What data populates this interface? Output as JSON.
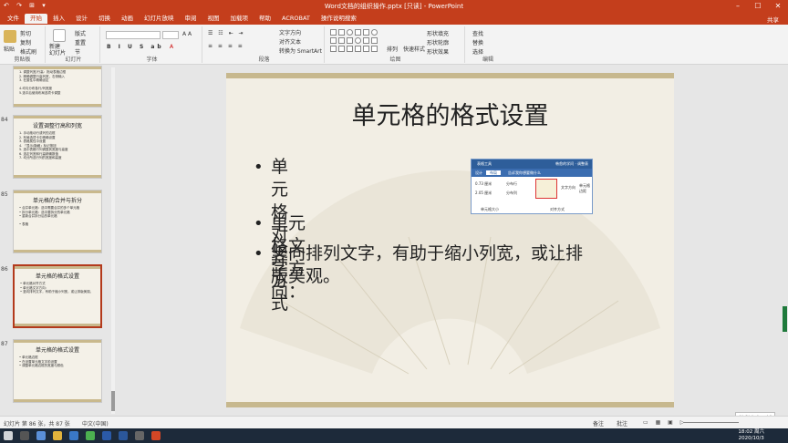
{
  "window": {
    "title": "Word文档的组织操作.pptx [只读] - PowerPoint",
    "qat": "↶ ↷ ⊞ ▾"
  },
  "tabs": [
    "文件",
    "开始",
    "插入",
    "设计",
    "切换",
    "动画",
    "幻灯片放映",
    "审阅",
    "视图",
    "加载项",
    "帮助",
    "ACROBAT",
    "操作说明搜索"
  ],
  "share": "共享",
  "ribbon": {
    "clipboard": {
      "label": "剪贴板",
      "paste": "粘贴",
      "cut": "剪切",
      "copy": "复制",
      "painter": "格式刷"
    },
    "slides": {
      "label": "幻灯片",
      "new": "新建\n幻灯片",
      "layout": "版式",
      "reset": "重置",
      "section": "节"
    },
    "font": {
      "label": "字体"
    },
    "paragraph": {
      "label": "段落",
      "text_dir": "文字方向",
      "align_text": "对齐文本",
      "smartart": "转换为 SmartArt"
    },
    "drawing": {
      "label": "绘图",
      "arrange": "排列",
      "quick_styles": "快速样式",
      "shape_fill": "形状填充",
      "shape_outline": "形状轮廓",
      "shape_effects": "形状效果"
    },
    "editing": {
      "label": "编辑",
      "find": "查找",
      "replace": "替换",
      "select": "选择"
    }
  },
  "thumbnails": [
    {
      "num": "",
      "title": "",
      "lines": [
        "1. 调整列宽/行高：拖动表格边框",
        "2. 精确调整行高列宽，右侧输入",
        "3. 在属性中精确设定",
        " ",
        "4.均匀分布各行/列宽度",
        "5.选中后使用布局选项卡调整"
      ],
      "selected": false
    },
    {
      "num": "84",
      "title": "设置调整行高和列宽",
      "lines": [
        "1. 手动拖动行或列的边框",
        "2. 布局选项卡中精确设置",
        "3. 表格属性中设置",
        "4. 「显示/隐藏」标记按钮",
        "5. 选中表格行列调整其宽度与高度",
        "6. 选定列宽和行高精确数值",
        "7. 均分所选行列的宽度和高度"
      ],
      "selected": false
    },
    {
      "num": "85",
      "title": "单元格的合并与拆分",
      "lines": [
        "• 合并单元格：选中需要合并的多个单元格",
        "• 拆分单元格：选中要拆分的单元格",
        "• 重新合并拆分后的单元格",
        " ",
        "• 表格"
      ],
      "selected": false
    },
    {
      "num": "86",
      "title": "单元格的格式设置",
      "lines": [
        "• 单元格对齐方式",
        "• 单元格文字方向：",
        "• 竖向排列文字，有助于缩小列宽，或让排版美观。"
      ],
      "selected": true
    },
    {
      "num": "87",
      "title": "单元格的格式设置",
      "lines": [
        "• 单元格边框",
        "• 在设置单元格文字前设置",
        "• 调整单元格边框的宽度与颜色"
      ],
      "selected": false
    }
  ],
  "slide": {
    "title": "单元格的格式设置",
    "bullets": [
      "单元格对齐方式",
      "单元格文字方向：",
      "竖向排列文字，有助于缩小列宽，或让排版美观。"
    ],
    "bullet_lines": [
      [
        "单元格对齐方式"
      ],
      [
        "单元格文字方向："
      ],
      [
        "竖向排列文字，有助于缩小列宽，或让排",
        "版美观。"
      ]
    ],
    "inset": {
      "header": "表格工具",
      "header_right": "韩愈的学问 · 调整表",
      "tab1": "设计",
      "tab2": "布局",
      "search": "告诉我你想要做什么",
      "height": "0.73 厘米",
      "width": "2.05 厘米",
      "dist_rows": "分布行",
      "dist_cols": "分布列",
      "text_dir": "文字方向",
      "margins": "单元格\n边距",
      "cell_size": "单元格大小",
      "alignment": "对齐方式"
    }
  },
  "statusbar": {
    "slide_info": "幻灯片 第 86 张，共 87 张",
    "lang": "中文(中国)",
    "notes": "备注",
    "comments": "批注",
    "zoom": "+ 63%"
  },
  "notification": "精彩内容更新",
  "taskbar": {
    "time": "18:02 周六",
    "date": "2020/10/3"
  },
  "colors": {
    "accent": "#c43e1c",
    "slide_band": "#c7b88e",
    "taskbar": "#1d2a3a"
  }
}
